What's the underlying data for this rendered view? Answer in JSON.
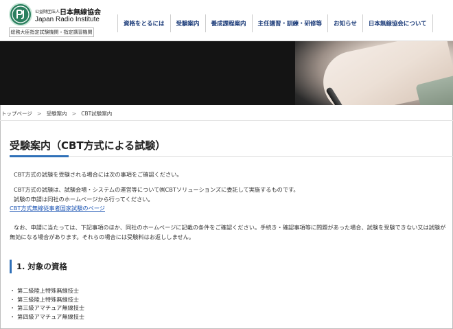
{
  "header": {
    "logo_label": "",
    "org_small": "公益財団法人",
    "org_name_jp": "日本無線協会",
    "org_name_en": "Japan Radio Institute",
    "org_sub": "総務大臣指定試験機関・指定講習機関"
  },
  "nav": {
    "items": [
      {
        "label": "資格をとるには"
      },
      {
        "label": "受験案内"
      },
      {
        "label": "養成課程案内"
      },
      {
        "label": "主任講習・訓練・研修等"
      },
      {
        "label": "お知らせ"
      },
      {
        "label": "日本無線協会について"
      }
    ]
  },
  "breadcrumb": {
    "items": [
      {
        "label": "トップページ"
      },
      {
        "label": "受験案内"
      },
      {
        "label": "CBT試験案内"
      }
    ],
    "separator": ">"
  },
  "main": {
    "title": "受験案内（CBT方式による試験）",
    "paragraphs": {
      "p1": "CBT方式の試験を受験される場合には次の事項をご確認ください。",
      "p2a": "CBT方式の試験は、試験会場・システムの運営等について㈱CBTソリューションズに委託して実施するものです。",
      "p2b": "試験の申請は同社のホームページから行ってください。",
      "link": "CBT方式無線従事者国家試験のページ",
      "p3a": "なお、申請に当たっては、下記事項のほか、同社のホームページに記載の条件をご確認ください。手続き・確認事項等に問題があった場合、試験を受験できない又は試験が",
      "p3b": "無効になる場合があります。それらの場合には受験料はお返ししません。"
    },
    "section1": {
      "title": "1. 対象の資格",
      "bullet": "・",
      "items": [
        "第二級陸上特殊無線技士",
        "第三級陸上特殊無線技士",
        "第三級アマチュア無線技士",
        "第四級アマチュア無線技士"
      ]
    }
  },
  "colors": {
    "accent": "#2f70b8",
    "nav_text": "#1a3a78",
    "link": "#1d56b4",
    "logo_green": "#2a7f5e"
  }
}
